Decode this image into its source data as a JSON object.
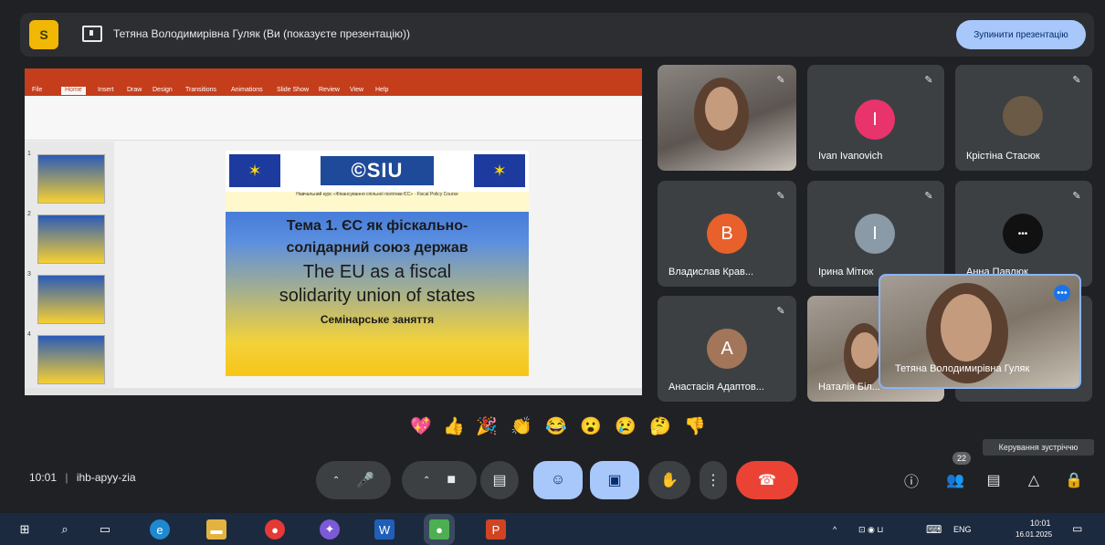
{
  "banner": {
    "logo_text": "S",
    "title": "Тетяна Володимирівна Гуляк (Ви (показуєте презентацію))",
    "stop_button": "Зупинити презентацію"
  },
  "presentation": {
    "tabs": [
      "File",
      "Home",
      "Insert",
      "Draw",
      "Design",
      "Transitions",
      "Animations",
      "Slide Show",
      "Review",
      "View",
      "Help"
    ],
    "thumb_numbers": [
      "1",
      "2",
      "3",
      "4"
    ],
    "slide": {
      "logo": "©SIU",
      "subtitle": "Навчальний курс «Фінансування спільної політики ЄС» · Fiscal Policy Course",
      "line1": "Тема 1. ЄС як фіскально-",
      "line2": "солідарний союз держав",
      "line3": "The EU as a fiscal",
      "line4": "solidarity union of states",
      "line5": "Семінарське заняття"
    }
  },
  "participants": [
    {
      "name": "",
      "type": "video"
    },
    {
      "name": "Ivan Ivanovich",
      "initial": "I",
      "color": "#e8336d",
      "muted": true
    },
    {
      "name": "Крістіна Стасюк",
      "type": "photo",
      "muted": true
    },
    {
      "name": "Владислав Крав...",
      "initial": "B",
      "color": "#e8602c",
      "muted": true
    },
    {
      "name": "Ірина Мітюк",
      "initial": "I",
      "color": "#8a9aa6",
      "muted": true
    },
    {
      "name": "Анна Павлюк",
      "initial": "•••",
      "color": "#111111",
      "muted": true
    },
    {
      "name": "Анастасія Адаптов...",
      "initial": "A",
      "color": "#a3765a",
      "muted": true
    },
    {
      "name": "Наталія Біл...",
      "type": "video"
    },
    {
      "name": "Тетяна Володимирівна Гуляк",
      "type": "self-video"
    }
  ],
  "reactions": [
    "💖",
    "👍",
    "🎉",
    "👏",
    "😂",
    "😮",
    "😢",
    "🤔",
    "👎"
  ],
  "meeting": {
    "time": "10:01",
    "code": "ihb-apyy-zia"
  },
  "controls": {
    "mic": "🎤",
    "camera": "■",
    "captions": "▤",
    "emoji": "☺",
    "present": "▣",
    "hand": "✋",
    "more": "⋮",
    "end": "☎"
  },
  "side_controls": {
    "people_count": "22",
    "tooltip": "Керування зустріччю"
  },
  "taskbar": {
    "language": "ENG",
    "time": "10:01",
    "date": "16.01.2025"
  }
}
